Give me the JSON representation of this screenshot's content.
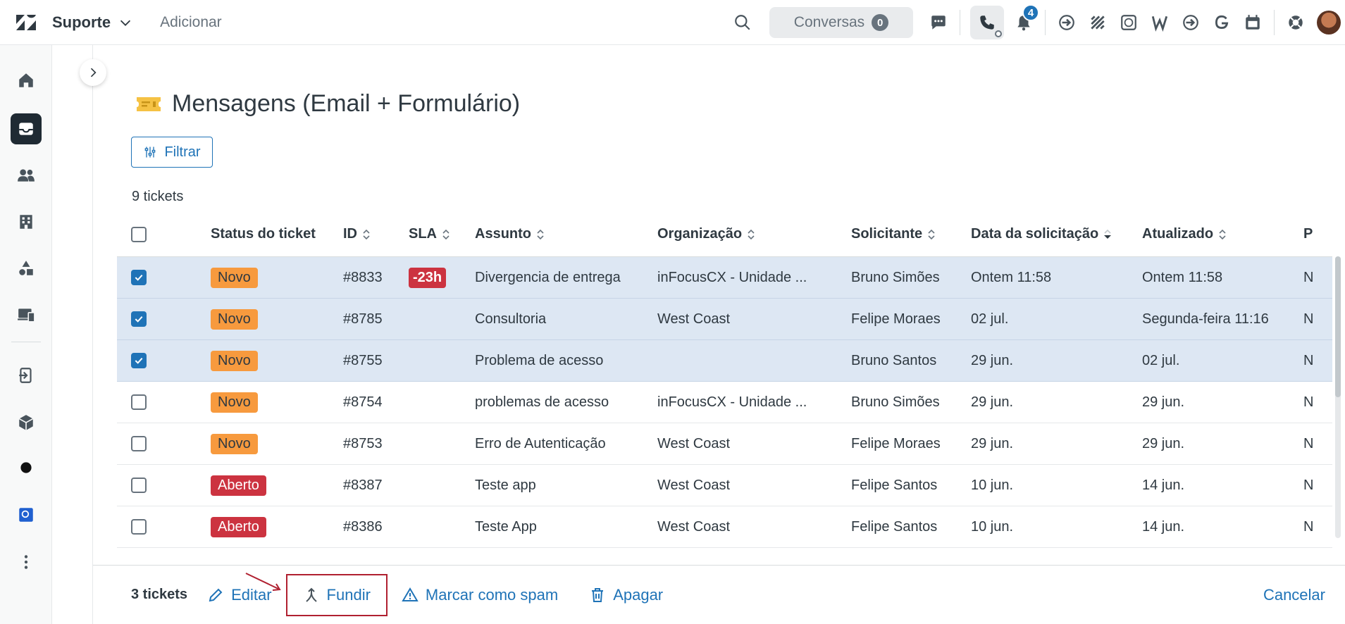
{
  "topbar": {
    "product_label": "Suporte",
    "add_label": "Adicionar",
    "conversations_label": "Conversas",
    "conversations_count": "0",
    "notifications_count": "4"
  },
  "view": {
    "title": "Mensagens (Email + Formulário)",
    "filter_label": "Filtrar",
    "ticket_count_label": "9 tickets"
  },
  "table": {
    "headers": {
      "status": "Status do ticket",
      "id": "ID",
      "sla": "SLA",
      "subject": "Assunto",
      "organization": "Organização",
      "requester": "Solicitante",
      "requested": "Data da solicitação",
      "updated": "Atualizado",
      "priority": "P"
    },
    "rows": [
      {
        "selected": true,
        "status": "Novo",
        "id": "#8833",
        "sla": "-23h",
        "subject": "Divergencia de entrega",
        "organization": "inFocusCX - Unidade ...",
        "requester": "Bruno Simões",
        "requested": "Ontem 11:58",
        "updated": "Ontem 11:58",
        "p": "N"
      },
      {
        "selected": true,
        "status": "Novo",
        "id": "#8785",
        "sla": "",
        "subject": "Consultoria",
        "organization": "West Coast",
        "requester": "Felipe Moraes",
        "requested": "02 jul.",
        "updated": "Segunda-feira 11:16",
        "p": "N"
      },
      {
        "selected": true,
        "status": "Novo",
        "id": "#8755",
        "sla": "",
        "subject": "Problema de acesso",
        "organization": "",
        "requester": "Bruno Santos",
        "requested": "29 jun.",
        "updated": "02 jul.",
        "p": "N"
      },
      {
        "selected": false,
        "status": "Novo",
        "id": "#8754",
        "sla": "",
        "subject": "problemas de acesso",
        "organization": "inFocusCX - Unidade ...",
        "requester": "Bruno Simões",
        "requested": "29 jun.",
        "updated": "29 jun.",
        "p": "N"
      },
      {
        "selected": false,
        "status": "Novo",
        "id": "#8753",
        "sla": "",
        "subject": "Erro de Autenticação",
        "organization": "West Coast",
        "requester": "Felipe Moraes",
        "requested": "29 jun.",
        "updated": "29 jun.",
        "p": "N"
      },
      {
        "selected": false,
        "status": "Aberto",
        "id": "#8387",
        "sla": "",
        "subject": "Teste app",
        "organization": "West Coast",
        "requester": "Felipe Santos",
        "requested": "10 jun.",
        "updated": "14 jun.",
        "p": "N"
      },
      {
        "selected": false,
        "status": "Aberto",
        "id": "#8386",
        "sla": "",
        "subject": "Teste App",
        "organization": "West Coast",
        "requester": "Felipe Santos",
        "requested": "10 jun.",
        "updated": "14 jun.",
        "p": "N"
      }
    ]
  },
  "bulk": {
    "count_label": "3 tickets",
    "edit_label": "Editar",
    "merge_label": "Fundir",
    "spam_label": "Marcar como spam",
    "delete_label": "Apagar",
    "cancel_label": "Cancelar"
  },
  "colors": {
    "accent": "#1f73b7",
    "status_new": "#f79a3e",
    "status_open": "#cc3340",
    "selected_row": "#dde7f3",
    "annotation": "#b02030"
  }
}
